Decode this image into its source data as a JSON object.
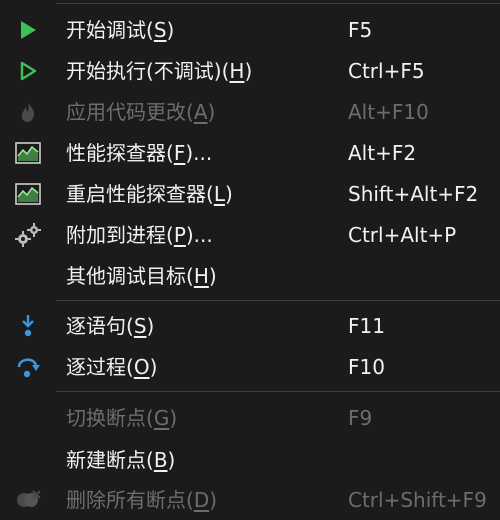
{
  "menu": {
    "items": [
      {
        "label_pre": "开始调试(",
        "accel": "S",
        "label_post": ")",
        "shortcut": "F5",
        "icon": "play-green-icon",
        "enabled": true
      },
      {
        "label_pre": "开始执行(不调试)(",
        "accel": "H",
        "label_post": ")",
        "shortcut": "Ctrl+F5",
        "icon": "play-outline-icon",
        "enabled": true
      },
      {
        "label_pre": "应用代码更改(",
        "accel": "A",
        "label_post": ")",
        "shortcut": "Alt+F10",
        "icon": "flame-icon",
        "enabled": false
      },
      {
        "label_pre": "性能探查器(",
        "accel": "F",
        "label_post": ")...",
        "shortcut": "Alt+F2",
        "icon": "performance-chart-icon",
        "enabled": true
      },
      {
        "label_pre": "重启性能探查器(",
        "accel": "L",
        "label_post": ")",
        "shortcut": "Shift+Alt+F2",
        "icon": "performance-chart-icon",
        "enabled": true
      },
      {
        "label_pre": "附加到进程(",
        "accel": "P",
        "label_post": ")...",
        "shortcut": "Ctrl+Alt+P",
        "icon": "gears-icon",
        "enabled": true
      },
      {
        "label_pre": "其他调试目标(",
        "accel": "H",
        "label_post": ")",
        "shortcut": "",
        "icon": "",
        "enabled": true
      },
      {
        "label_pre": "逐语句(",
        "accel": "S",
        "label_post": ")",
        "shortcut": "F11",
        "icon": "step-into-icon",
        "enabled": true
      },
      {
        "label_pre": "逐过程(",
        "accel": "O",
        "label_post": ")",
        "shortcut": "F10",
        "icon": "step-over-icon",
        "enabled": true
      },
      {
        "label_pre": "切换断点(",
        "accel": "G",
        "label_post": ")",
        "shortcut": "F9",
        "icon": "",
        "enabled": false
      },
      {
        "label_pre": "新建断点(",
        "accel": "B",
        "label_post": ")",
        "shortcut": "",
        "icon": "",
        "enabled": true
      },
      {
        "label_pre": "删除所有断点(",
        "accel": "D",
        "label_post": ")",
        "shortcut": "Ctrl+Shift+F9",
        "icon": "delete-breakpoints-icon",
        "enabled": false
      }
    ]
  },
  "colors": {
    "background": "#1b1b1c",
    "text": "#f1f1f1",
    "disabled_text": "#6d6d6d",
    "separator": "#3f3f46",
    "play_green": "#3ec156",
    "step_blue": "#3a96dd"
  }
}
